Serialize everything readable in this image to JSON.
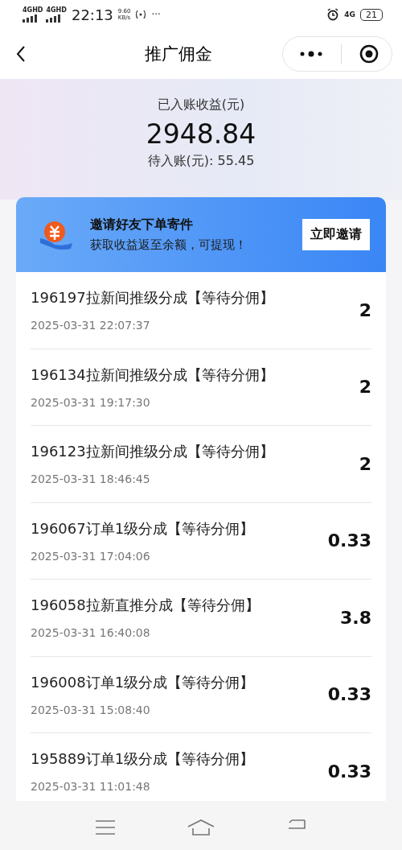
{
  "status_bar": {
    "sim_labels": [
      "4GHD",
      "4GHD"
    ],
    "time": "22:13",
    "speed_value": "9.60",
    "speed_unit": "KB/s",
    "more": "···",
    "network": "4G",
    "battery": "21"
  },
  "header": {
    "title": "推广佣金"
  },
  "summary": {
    "label": "已入账收益(元)",
    "amount": "2948.84",
    "pending": "待入账(元): 55.45"
  },
  "banner": {
    "title": "邀请好友下单寄件",
    "subtitle": "获取收益返至余额，可提现！",
    "button": "立即邀请"
  },
  "records": [
    {
      "title": "196197拉新间推级分成【等待分佣】",
      "time": "2025-03-31 22:07:37",
      "amount": "2"
    },
    {
      "title": "196134拉新间推级分成【等待分佣】",
      "time": "2025-03-31 19:17:30",
      "amount": "2"
    },
    {
      "title": "196123拉新间推级分成【等待分佣】",
      "time": "2025-03-31 18:46:45",
      "amount": "2"
    },
    {
      "title": "196067订单1级分成【等待分佣】",
      "time": "2025-03-31 17:04:06",
      "amount": "0.33"
    },
    {
      "title": "196058拉新直推分成【等待分佣】",
      "time": "2025-03-31 16:40:08",
      "amount": "3.8"
    },
    {
      "title": "196008订单1级分成【等待分佣】",
      "time": "2025-03-31 15:08:40",
      "amount": "0.33"
    },
    {
      "title": "195889订单1级分成【等待分佣】",
      "time": "2025-03-31 11:01:48",
      "amount": "0.33"
    }
  ]
}
